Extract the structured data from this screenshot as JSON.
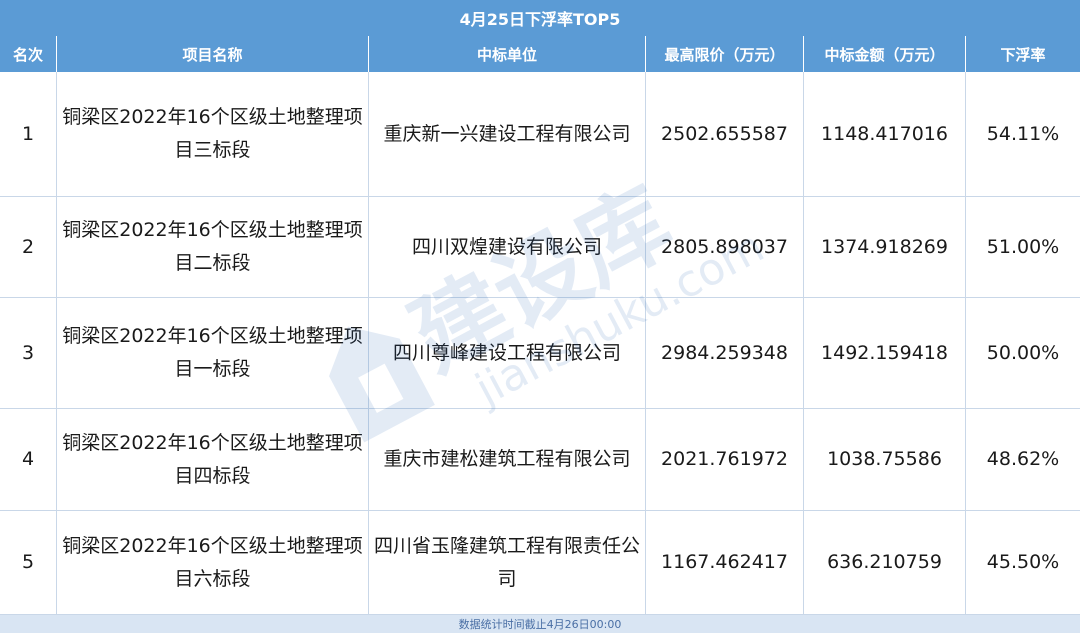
{
  "title": "4月25日下浮率TOP5",
  "columns": [
    "名次",
    "项目名称",
    "中标单位",
    "最高限价（万元）",
    "中标金额（万元）",
    "下浮率"
  ],
  "rows": [
    {
      "rank": "1",
      "project": "铜梁区2022年16个区级土地整理项目三标段",
      "winner": "重庆新一兴建设工程有限公司",
      "max_price": "2502.655587",
      "bid_amount": "1148.417016",
      "discount": "54.11%"
    },
    {
      "rank": "2",
      "project": "铜梁区2022年16个区级土地整理项目二标段",
      "winner": "四川双煌建设有限公司",
      "max_price": "2805.898037",
      "bid_amount": "1374.918269",
      "discount": "51.00%"
    },
    {
      "rank": "3",
      "project": "铜梁区2022年16个区级土地整理项目一标段",
      "winner": "四川尊峰建设工程有限公司",
      "max_price": "2984.259348",
      "bid_amount": "1492.159418",
      "discount": "50.00%"
    },
    {
      "rank": "4",
      "project": "铜梁区2022年16个区级土地整理项目四标段",
      "winner": "重庆市建松建筑工程有限公司",
      "max_price": "2021.761972",
      "bid_amount": "1038.75586",
      "discount": "48.62%"
    },
    {
      "rank": "5",
      "project": "铜梁区2022年16个区级土地整理项目六标段",
      "winner": "四川省玉隆建筑工程有限责任公司",
      "max_price": "1167.462417",
      "bid_amount": "636.210759",
      "discount": "45.50%"
    }
  ],
  "footer": "数据统计时间截止4月26日00:00",
  "watermark": {
    "main": "建设库",
    "sub": "jianshuku.com",
    "icon": "house-logo-icon"
  },
  "colors": {
    "header": "#5b9bd5",
    "footer_bg": "#d9e5f3",
    "watermark": "#1f5fb3"
  }
}
